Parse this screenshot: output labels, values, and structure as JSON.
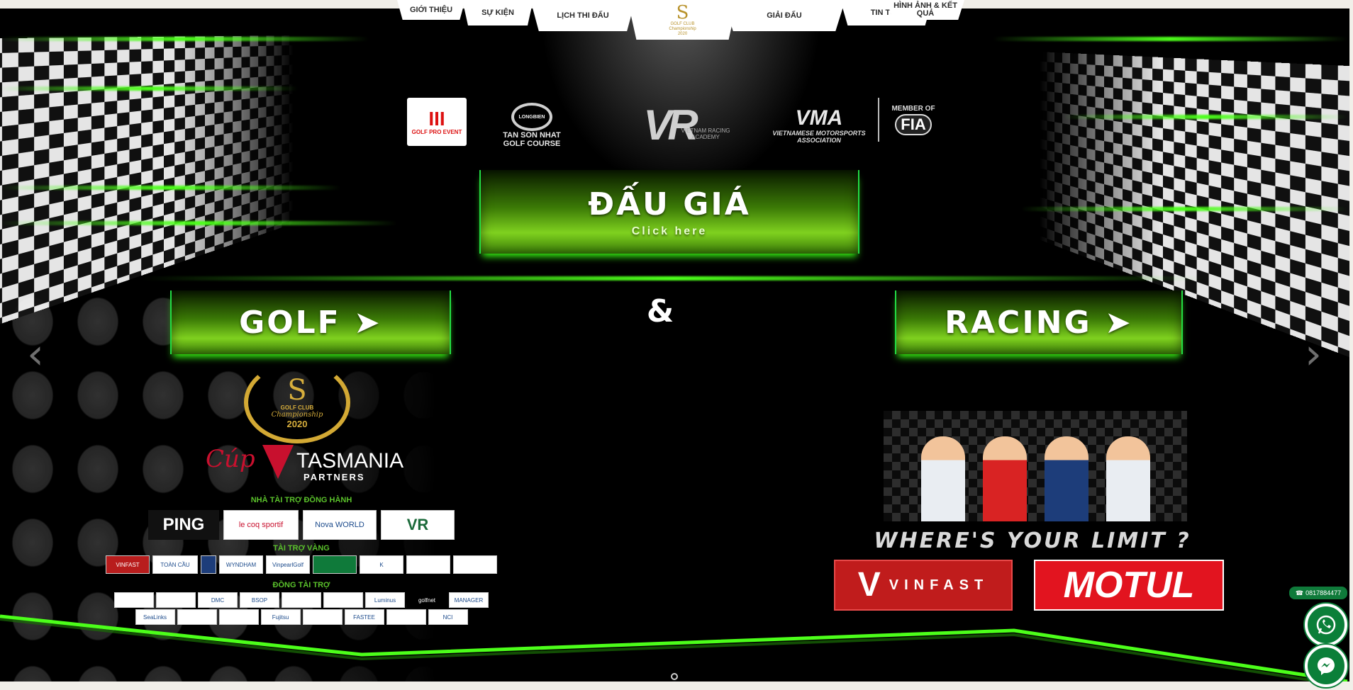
{
  "nav": {
    "items": [
      {
        "label": "GIỚI THIỆU"
      },
      {
        "label": "SỰ KIỆN"
      },
      {
        "label": "LỊCH THI ĐẤU"
      },
      {
        "label": "GIẢI ĐẤU"
      },
      {
        "label": "TIN TỨC"
      },
      {
        "label": "HÌNH ẢNH & KẾT QUẢ"
      }
    ],
    "logo": {
      "letter": "S",
      "line1": "GOLF CLUB",
      "line2": "Championship",
      "year": "2020"
    }
  },
  "partners": {
    "golfpro": {
      "bars": "III",
      "text": "GOLF PRO EVENT"
    },
    "longbien": {
      "ring": "LONGBIEN",
      "line1": "TAN SON NHAT",
      "line2": "GOLF COURSE"
    },
    "vr": {
      "mark": "VR",
      "text": "VIETNAM RACING ACADEMY"
    },
    "vma": {
      "mark": "VMA",
      "line1": "VIETNAMESE MOTORSPORTS",
      "line2": "ASSOCIATION"
    },
    "fia": {
      "member": "MEMBER OF",
      "mark": "FIA"
    }
  },
  "auction": {
    "title": "ĐẤU GIÁ",
    "cta": "Click here"
  },
  "golf_button": {
    "label": "GOLF ➤"
  },
  "ampersand": "&",
  "racing_button": {
    "label": "RACING ➤"
  },
  "carousel": {
    "prev_icon": "chevron-left-icon",
    "next_icon": "chevron-right-icon",
    "prev_glyph": "‹",
    "next_glyph": "›"
  },
  "golf_section": {
    "emblem": {
      "letter": "S",
      "line1": "GOLF CLUB",
      "line2": "Championship",
      "year": "2020"
    },
    "cup": {
      "cup": "Cúp",
      "brand": "TASMANIA",
      "partners": "PARTNERS"
    },
    "companion_heading": "NHÀ TÀI TRỢ ĐỒNG HÀNH",
    "companion": [
      "PING",
      "le coq sportif",
      "Nova WORLD",
      "VR"
    ],
    "gold_heading": "TÀI TRỢ VÀNG",
    "gold": [
      "VINFAST",
      "TOÀN CẦU",
      "",
      "WYNDHAM",
      "VinpearlGolf",
      "",
      "K",
      "",
      ""
    ],
    "co_heading": "ĐỒNG TÀI TRỢ",
    "co_row1": [
      "",
      "",
      "DMC",
      "BSOP",
      "",
      "",
      "Luminus",
      "golfnet",
      "MANAGER"
    ],
    "co_row2": [
      "SeaLinks",
      "",
      "",
      "Fujitsu",
      "",
      "FASTEE",
      "",
      "NCI"
    ]
  },
  "racing_section": {
    "tagline": "WHERE'S YOUR LIMIT ?",
    "vinfast": {
      "mark": "V",
      "text": "VINFAST"
    },
    "motul": "MOTUL"
  },
  "contact": {
    "phone": "0817884477",
    "phone_icon": "☎"
  },
  "colors": {
    "accent": "#39ff14",
    "button_green": "#7fd11f",
    "contact_green": "#0b7f39",
    "gold": "#d3a934",
    "brand_red": "#c8102e"
  }
}
